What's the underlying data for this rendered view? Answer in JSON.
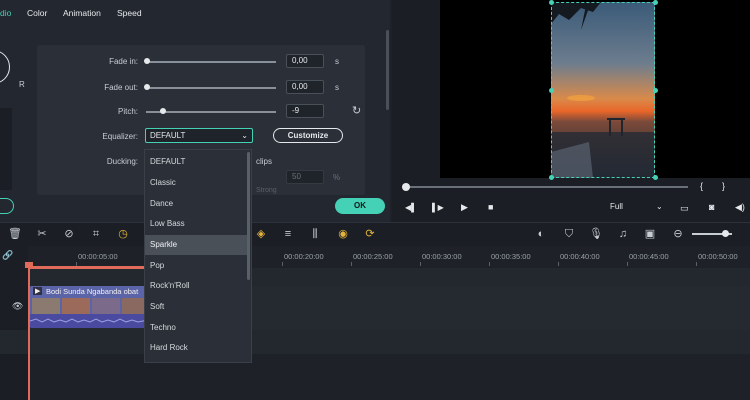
{
  "tabs": [
    {
      "label": "dio",
      "active": true
    },
    {
      "label": "Color"
    },
    {
      "label": "Animation"
    },
    {
      "label": "Speed"
    }
  ],
  "side_letter": "R",
  "audio": {
    "fade_in": {
      "label": "Fade in:",
      "value": "0,00",
      "unit": "s"
    },
    "fade_out": {
      "label": "Fade out:",
      "value": "0,00",
      "unit": "s"
    },
    "pitch": {
      "label": "Pitch:",
      "value": "-9"
    },
    "equalizer": {
      "label": "Equalizer:",
      "value": "DEFAULT"
    },
    "customize_label": "Customize",
    "ducking": {
      "label": "Ducking:",
      "clips_text": "clips",
      "value": "50",
      "unit": "%",
      "faded_text": "Strong"
    },
    "ok_label": "OK"
  },
  "equalizer_options": [
    "DEFAULT",
    "Classic",
    "Dance",
    "Low Bass",
    "Sparkle",
    "Pop",
    "Rock'n'Roll",
    "Soft",
    "Techno",
    "Hard Rock"
  ],
  "equalizer_hover": "Sparkle",
  "preview": {
    "bracket_left": "{",
    "bracket_right": "}",
    "quality": "Full"
  },
  "ruler_labels": [
    "00:00:05:00",
    "00:00:20:00",
    "00:00:25:00",
    "00:00:30:00",
    "00:00:35:00",
    "00:00:40:00",
    "00:00:45:00",
    "00:00:50:00"
  ],
  "clip": {
    "title": "Bodi Sunda Ngabanda obat"
  },
  "colors": {
    "accent": "#45d1b6",
    "playhead": "#e06b5b",
    "clip": "#5a5ab0",
    "toolbar_gold": "#e3b33b"
  }
}
